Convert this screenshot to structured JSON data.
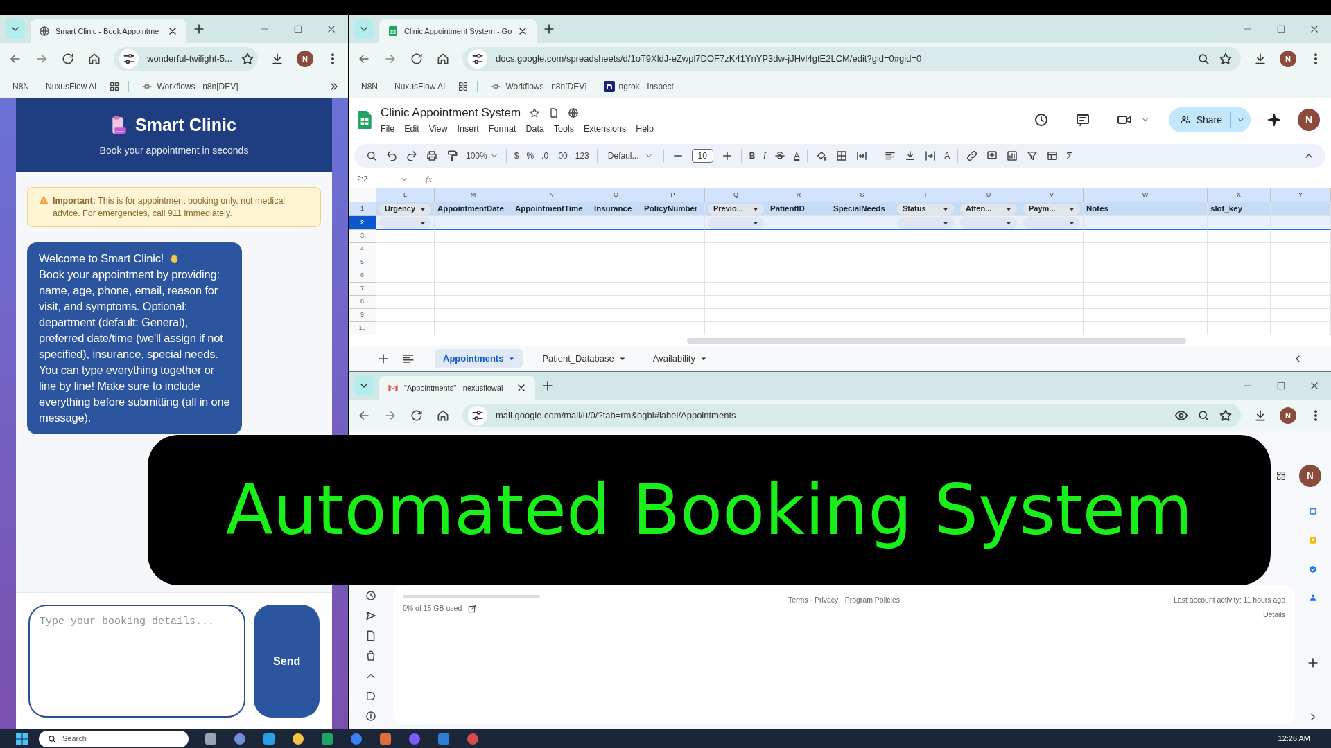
{
  "clinic_window": {
    "browser": {
      "tab_title": "Smart Clinic - Book Appointme",
      "url": "wonderful-twilight-5...",
      "avatar": "N",
      "bookmarks": [
        {
          "label": "N8N",
          "kind": "plain"
        },
        {
          "label": "NuxusFlow AI",
          "kind": "plain"
        },
        {
          "label": "Workflows - n8n[DEV]",
          "kind": "workflow"
        }
      ]
    },
    "header": {
      "title": "Smart Clinic",
      "subtitle": "Book your appointment in seconds"
    },
    "notice": "**Important:** This is for appointment booking only, not medical advice. For emergencies, call 911 immediately.",
    "messages": [
      {
        "before_emoji": "Welcome to Smart Clinic!",
        "after_emoji": "Book your appointment by providing: name, age, phone, email, reason for visit, and symptoms. Optional: department (default: General), preferred date/time (we'll assign if not specified), insurance, special needs. You can type everything together or line by line! Make sure to include everything before submitting (all in one message)."
      }
    ],
    "composer": {
      "placeholder": "Type your booking details...",
      "send": "Send"
    }
  },
  "sheets_window": {
    "browser": {
      "tab_title": "Clinic Appointment System - Go",
      "url": "docs.google.com/spreadsheets/d/1oT9XldJ-eZwpl7DOF7zK41YnYP3dw-jJHvl4gtE2LCM/edit?gid=0#gid=0",
      "avatar": "N",
      "bookmarks": [
        {
          "label": "N8N",
          "kind": "plain"
        },
        {
          "label": "NuxusFlow AI",
          "kind": "plain"
        },
        {
          "label": "Workflows - n8n[DEV]",
          "kind": "workflow"
        },
        {
          "label": "ngrok - Inspect",
          "kind": "ngrok"
        }
      ]
    },
    "doc_title": "Clinic Appointment System",
    "menus": [
      "File",
      "Edit",
      "View",
      "Insert",
      "Format",
      "Data",
      "Tools",
      "Extensions",
      "Help"
    ],
    "share": "Share",
    "avatar": "N",
    "toolbar": {
      "zoom": "100%",
      "currency": "$",
      "percent": "%",
      "decimal_less": ".0",
      "decimal_more": ".00",
      "number_format": "123",
      "font": "Defaul...",
      "font_size": "10",
      "bold": "B",
      "italic": "I",
      "text_color": "A",
      "text_rotation": "A",
      "sum": "Σ"
    },
    "name_box": "2:2",
    "formula_label": "fx",
    "columns": [
      {
        "letter": "L",
        "header": "Urgency",
        "header_chip": true,
        "row_chip": true
      },
      {
        "letter": "M",
        "header": "AppointmentDate",
        "header_chip": false,
        "row_chip": false
      },
      {
        "letter": "N",
        "header": "AppointmentTime",
        "header_chip": false,
        "row_chip": false
      },
      {
        "letter": "O",
        "header": "Insurance",
        "header_chip": false,
        "row_chip": false
      },
      {
        "letter": "P",
        "header": "PolicyNumber",
        "header_chip": false,
        "row_chip": false
      },
      {
        "letter": "Q",
        "header": "Previo...",
        "header_chip": true,
        "row_chip": true
      },
      {
        "letter": "R",
        "header": "PatientID",
        "header_chip": false,
        "row_chip": false
      },
      {
        "letter": "S",
        "header": "SpecialNeeds",
        "header_chip": false,
        "row_chip": false
      },
      {
        "letter": "T",
        "header": "Status",
        "header_chip": true,
        "row_chip": true
      },
      {
        "letter": "U",
        "header": "Atten...",
        "header_chip": true,
        "row_chip": true
      },
      {
        "letter": "V",
        "header": "Paym...",
        "header_chip": true,
        "row_chip": true
      },
      {
        "letter": "W",
        "header": "Notes",
        "header_chip": false,
        "row_chip": false
      },
      {
        "letter": "X",
        "header": "slot_key",
        "header_chip": false,
        "row_chip": false
      },
      {
        "letter": "Y",
        "row_chip": false
      }
    ],
    "rows": [
      {
        "number": "1",
        "selected": false
      },
      {
        "number": "2",
        "selected": true
      },
      {
        "number": "3",
        "selected": false
      },
      {
        "number": "4",
        "selected": false
      },
      {
        "number": "5",
        "selected": false
      },
      {
        "number": "6",
        "selected": false
      },
      {
        "number": "7",
        "selected": false
      },
      {
        "number": "8",
        "selected": false
      },
      {
        "number": "9",
        "selected": false
      },
      {
        "number": "10",
        "selected": false
      }
    ],
    "sheet_tabs": [
      {
        "label": "Appointments",
        "selected": true
      },
      {
        "label": "Patient_Database",
        "selected": false
      },
      {
        "label": "Availability",
        "selected": false
      }
    ]
  },
  "gmail_window": {
    "browser": {
      "tab_title": "\"Appointments\" - nexusflowai",
      "url": "mail.google.com/mail/u/0/?tab=rm&ogbl#label/Appointments",
      "avatar": "N"
    },
    "account_avatar": "N",
    "storage": "0% of 15 GB used",
    "footer_links": "Terms · Privacy · Program Policies",
    "last_activity": "Last account activity: 11 hours ago",
    "details": "Details"
  },
  "caption_overlay": {
    "text": "Automated Booking System"
  },
  "taskbar": {
    "search_placeholder": "Search",
    "clock": "12:26 AM"
  }
}
